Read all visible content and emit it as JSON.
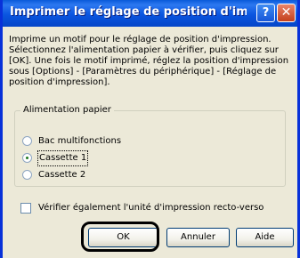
{
  "window": {
    "title": "Imprimer le réglage de position d'impression",
    "help_glyph": "?",
    "close_glyph": "✕"
  },
  "description": "Imprime un motif pour le réglage de position d'impression. Sélectionnez l'alimentation papier à vérifier, puis cliquez sur [OK]. Une fois le motif imprimé, réglez la position d'impression sous [Options] - [Paramètres du périphérique] - [Réglage de position d'impression].",
  "paper_source": {
    "label": "Alimentation papier",
    "options": [
      {
        "label": "Bac multifonctions",
        "selected": false
      },
      {
        "label": "Cassette 1",
        "selected": true
      },
      {
        "label": "Cassette 2",
        "selected": false
      }
    ]
  },
  "duplex_check": {
    "label": "Vérifier également l'unité d'impression recto-verso",
    "checked": false
  },
  "buttons": {
    "ok": "OK",
    "cancel": "Annuler",
    "help": "Aide"
  }
}
